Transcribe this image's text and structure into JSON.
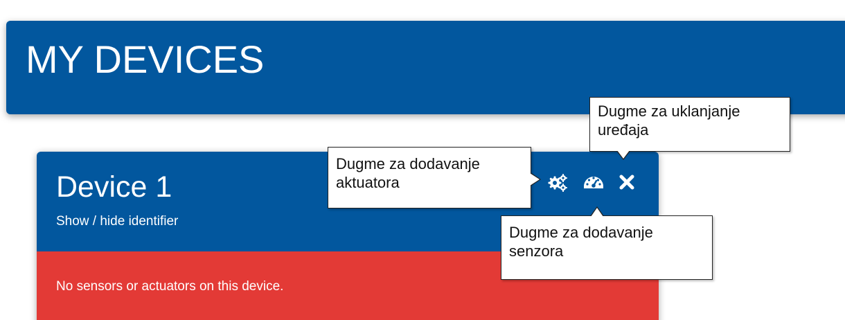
{
  "header": {
    "title": "MY DEVICES"
  },
  "device": {
    "name": "Device 1",
    "toggle_identifier_label": "Show / hide identifier",
    "empty_message": "No sensors or actuators on this device.",
    "actions": [
      {
        "icon": "gears-icon"
      },
      {
        "icon": "tachometer-icon"
      },
      {
        "icon": "close-icon"
      }
    ]
  },
  "callouts": {
    "remove_device": {
      "line1": "Dugme za uklanjanje",
      "line2": "uređaja"
    },
    "add_actuator": {
      "line1": "Dugme za dodavanje",
      "line2": "aktuatora"
    },
    "add_sensor": {
      "line1": "Dugme za dodavanje",
      "line2": "senzora"
    }
  },
  "colors": {
    "primary_blue": "#02579e",
    "alert_red": "#e33a36",
    "text_white": "#ffffff"
  }
}
